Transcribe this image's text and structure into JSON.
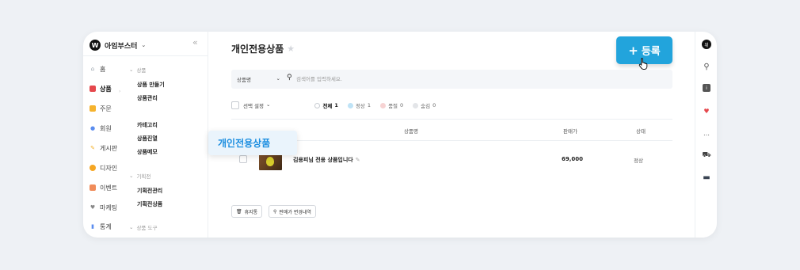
{
  "brand": {
    "logo": "W",
    "name": "아임부스터",
    "caret": "⌄",
    "collapse": "«"
  },
  "nav": {
    "items": [
      {
        "label": "홈",
        "icon": "⌂",
        "color": "#9aa3ad"
      },
      {
        "label": "상품",
        "icon": "■",
        "color": "#e5484d"
      },
      {
        "label": "주문",
        "icon": "■",
        "color": "#f5b32e"
      },
      {
        "label": "회원",
        "icon": "●",
        "color": "#5b8def"
      },
      {
        "label": "게시판",
        "icon": "✎",
        "color": "#f5b32e"
      },
      {
        "label": "디자인",
        "icon": "●",
        "color": "#f5a623"
      },
      {
        "label": "이벤트",
        "icon": "■",
        "color": "#f08c5a"
      },
      {
        "label": "마케팅",
        "icon": "♥",
        "color": "#888888"
      },
      {
        "label": "통계",
        "icon": "▮",
        "color": "#5b8def"
      }
    ],
    "sub_sections": [
      {
        "label": "상품",
        "items": [
          "상품 만들기",
          "상품관리",
          "카테고리",
          "상품진열",
          "상품메모"
        ]
      },
      {
        "label": "기획전",
        "items": [
          "기획전관리",
          "기획전상품"
        ]
      },
      {
        "label": "상품 도구",
        "items": []
      }
    ]
  },
  "tooltip": {
    "label": "개인전용상품"
  },
  "page": {
    "title": "개인전용상품"
  },
  "register_button": {
    "plus": "+",
    "label": "등록"
  },
  "search": {
    "select_value": "상품명",
    "placeholder": "검색어를 입력하세요."
  },
  "filters": {
    "select_label": "선택 설정",
    "statuses": [
      {
        "label": "전체",
        "count": "1",
        "color": "#ffffff",
        "border": "#c8ccd2"
      },
      {
        "label": "정상",
        "count": "1",
        "color": "#bfe3f6",
        "border": "#bfe3f6"
      },
      {
        "label": "품절",
        "count": "0",
        "color": "#f7d3d3",
        "border": "#f7d3d3"
      },
      {
        "label": "숨김",
        "count": "0",
        "color": "#e3e5e8",
        "border": "#e3e5e8"
      }
    ]
  },
  "table": {
    "headers": [
      "상품명",
      "판매가",
      "상태"
    ],
    "rows": [
      {
        "name": "김용피님 전용 상품입니다",
        "price": "69,000",
        "state": "정상"
      }
    ]
  },
  "bottom_buttons": [
    {
      "icon": "🗑",
      "label": "휴지통"
    },
    {
      "icon": "⚲",
      "label": "판매가 변경내역"
    }
  ],
  "right_rail": [
    {
      "name": "profile-icon",
      "glyph": "위"
    },
    {
      "name": "search-icon",
      "glyph": "⚲"
    },
    {
      "name": "info-icon",
      "glyph": "i"
    },
    {
      "name": "message-icon",
      "glyph": "♥"
    },
    {
      "name": "chat-icon",
      "glyph": "…"
    },
    {
      "name": "cart-icon",
      "glyph": "⛟"
    },
    {
      "name": "monitor-icon",
      "glyph": "▬"
    }
  ]
}
